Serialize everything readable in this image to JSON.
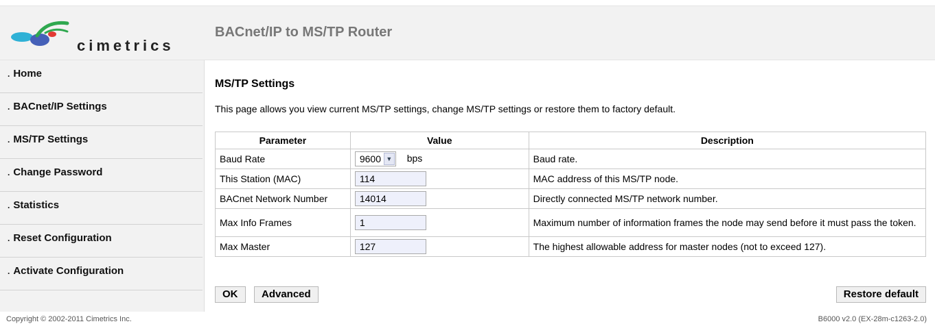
{
  "header": {
    "logo_text": "cimetrics",
    "app_title": "BACnet/IP to MS/TP Router"
  },
  "sidebar": {
    "items": [
      {
        "label": "Home"
      },
      {
        "label": "BACnet/IP Settings"
      },
      {
        "label": "MS/TP Settings"
      },
      {
        "label": "Change Password"
      },
      {
        "label": "Statistics"
      },
      {
        "label": "Reset Configuration"
      },
      {
        "label": "Activate Configuration"
      }
    ]
  },
  "main": {
    "title": "MS/TP Settings",
    "intro": "This page allows you view current MS/TP settings, change MS/TP settings or restore them to factory default.",
    "table": {
      "headers": [
        "Parameter",
        "Value",
        "Description"
      ],
      "rows": [
        {
          "parameter": "Baud Rate",
          "value": "9600",
          "unit": "bps",
          "description": "Baud rate."
        },
        {
          "parameter": "This Station (MAC)",
          "value": "114",
          "description": "MAC address of this MS/TP node."
        },
        {
          "parameter": "BACnet Network Number",
          "value": "14014",
          "description": "Directly connected MS/TP network number."
        },
        {
          "parameter": "Max Info Frames",
          "value": "1",
          "description": "Maximum number of information frames the node may send before it must pass the token."
        },
        {
          "parameter": "Max Master",
          "value": "127",
          "description": "The highest allowable address for master nodes (not to exceed 127)."
        }
      ]
    },
    "buttons": {
      "ok": "OK",
      "advanced": "Advanced",
      "restore": "Restore default"
    }
  },
  "footer": {
    "copyright": "Copyright © 2002-2011 Cimetrics Inc.",
    "version": "B6000 v2.0 (EX-28m-c1263-2.0)"
  },
  "icons": {
    "logo": "cimetrics-logo-icon",
    "select_arrow": "chevron-down-icon",
    "bullet": "bullet-icon"
  },
  "colors": {
    "header_bg": "#f2f2f2",
    "title_gray": "#777777",
    "input_bg": "#eef0fb"
  }
}
